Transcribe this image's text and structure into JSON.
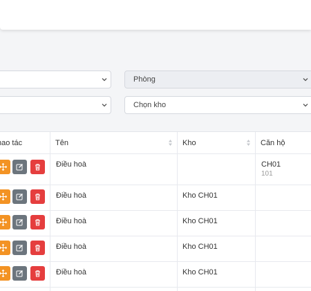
{
  "filters": {
    "row1": {
      "left_value": "",
      "room_placeholder": "Phòng"
    },
    "row2": {
      "left_value": "",
      "warehouse_placeholder": "Chọn kho"
    }
  },
  "table": {
    "columns": [
      "hao tác",
      "Tên",
      "Kho",
      "Căn hộ"
    ],
    "rows": [
      {
        "name": "Điều hoà",
        "warehouse": "",
        "apartment": "CH01",
        "apartment_sub": "101"
      },
      {
        "name": "Điều hoà",
        "warehouse": "Kho CH01",
        "apartment": "",
        "apartment_sub": ""
      },
      {
        "name": "Điều hoà",
        "warehouse": "Kho CH01",
        "apartment": "",
        "apartment_sub": ""
      },
      {
        "name": "Điều hoà",
        "warehouse": "Kho CH01",
        "apartment": "",
        "apartment_sub": ""
      },
      {
        "name": "Điều hoà",
        "warehouse": "Kho CH01",
        "apartment": "",
        "apartment_sub": ""
      }
    ]
  },
  "colors": {
    "move": "#f39324",
    "edit": "#6c757d",
    "delete": "#e53e3e"
  },
  "icons": {
    "move": "move-icon",
    "edit": "edit-icon",
    "delete": "trash-icon"
  }
}
